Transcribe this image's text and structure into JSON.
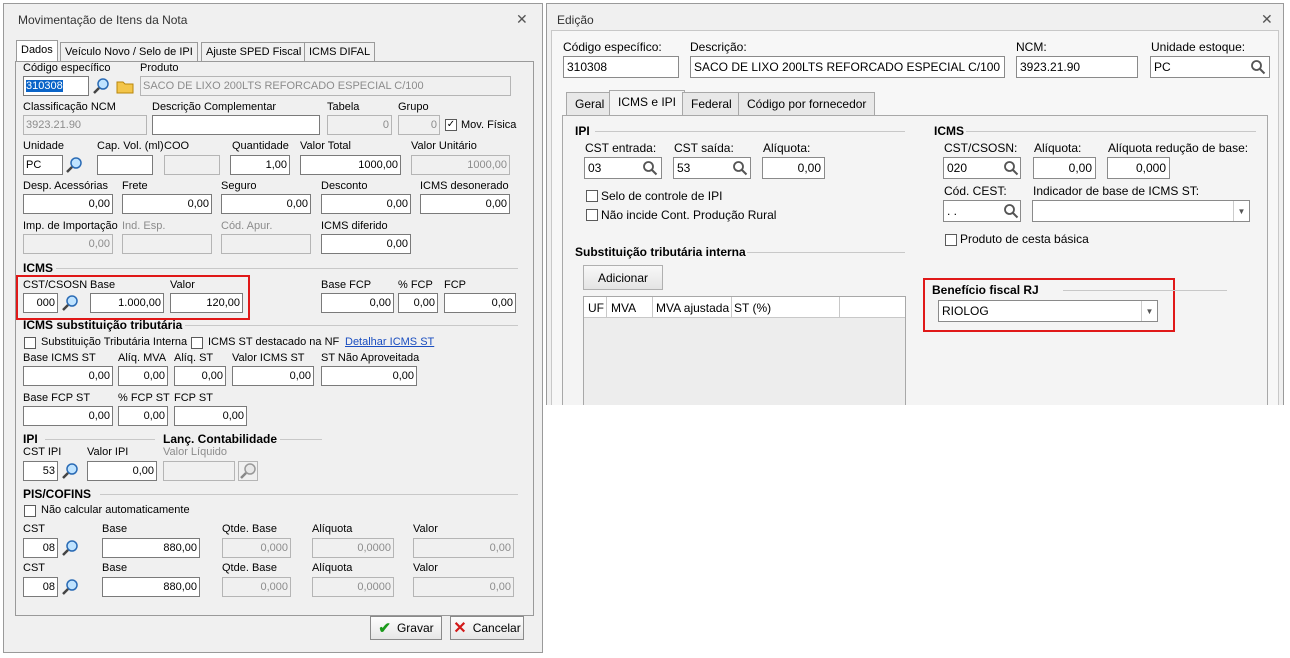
{
  "left": {
    "title": "Movimentação de Itens da Nota",
    "tabs": [
      "Dados",
      "Veículo Novo / Selo de IPI",
      "Ajuste SPED Fiscal",
      "ICMS DIFAL"
    ],
    "codigo_especifico_label": "Código específico",
    "codigo_especifico": "310308",
    "produto_label": "Produto",
    "produto": "SACO DE LIXO 200LTS REFORCADO ESPECIAL C/100",
    "classificacao_ncm_label": "Classificação NCM",
    "classificacao_ncm": "3923.21.90",
    "descricao_complementar_label": "Descrição Complementar",
    "descricao_complementar": "",
    "tabela_label": "Tabela",
    "tabela": "0",
    "grupo_label": "Grupo",
    "grupo": "0",
    "mov_fisica_label": "Mov. Física",
    "mov_fisica_check": "✓",
    "unidade_label": "Unidade",
    "unidade": "PC",
    "cap_vol_label": "Cap. Vol. (ml)",
    "coo_label": "COO",
    "quantidade_label": "Quantidade",
    "quantidade": "1,00",
    "valor_total_label": "Valor Total",
    "valor_total": "1000,00",
    "valor_unitario_label": "Valor Unitário",
    "valor_unitario": "1000,00",
    "desp_acessorias_label": "Desp. Acessórias",
    "desp_acessorias": "0,00",
    "frete_label": "Frete",
    "frete": "0,00",
    "seguro_label": "Seguro",
    "seguro": "0,00",
    "desconto_label": "Desconto",
    "desconto": "0,00",
    "icms_desonerado_label": "ICMS desonerado",
    "icms_desonerado": "0,00",
    "imp_importacao_label": "Imp. de Importação",
    "imp_importacao": "0,00",
    "ind_esp_label": "Ind. Esp.",
    "cod_apur_label": "Cód. Apur.",
    "icms_diferido_label": "ICMS diferido",
    "icms_diferido": "0,00",
    "icms_section": "ICMS",
    "cst_csosn_label": "CST/CSOSN",
    "cst_csosn": "000",
    "base_label": "Base",
    "base": "1.000,00",
    "valor_label": "Valor",
    "valor": "120,00",
    "base_fcp_label": "Base FCP",
    "base_fcp": "0,00",
    "pct_fcp_label": "% FCP",
    "pct_fcp": "0,00",
    "fcp_label": "FCP",
    "fcp": "0,00",
    "icms_st_section": "ICMS substituição tributária",
    "subst_trib_interna_label": "Substituição Tributária Interna",
    "icms_st_destacado_label": "ICMS ST destacado na NF",
    "detalhar_icms_st": "Detalhar ICMS ST",
    "base_icms_st_label": "Base ICMS ST",
    "base_icms_st": "0,00",
    "aliq_mva_label": "Alíq. MVA",
    "aliq_mva": "0,00",
    "aliq_st_label": "Alíq. ST",
    "aliq_st": "0,00",
    "valor_icms_st_label": "Valor ICMS ST",
    "valor_icms_st": "0,00",
    "st_nao_aproveitada_label": "ST Não Aproveitada",
    "st_nao_aproveitada": "0,00",
    "base_fcp_st_label": "Base FCP ST",
    "base_fcp_st": "0,00",
    "pct_fcp_st_label": "% FCP ST",
    "pct_fcp_st": "0,00",
    "fcp_st_label": "FCP ST",
    "fcp_st": "0,00",
    "ipi_section": "IPI",
    "lanc_contabilidade_section": "Lanç. Contabilidade",
    "cst_ipi_label": "CST IPI",
    "cst_ipi": "53",
    "valor_ipi_label": "Valor IPI",
    "valor_ipi": "0,00",
    "valor_liquido_label": "Valor Líquido",
    "pis_cofins_section": "PIS/COFINS",
    "nao_calcular_label": "Não calcular automaticamente",
    "cst_label": "CST",
    "base2_label": "Base",
    "qtde_base_label": "Qtde. Base",
    "aliquota_label": "Alíquota",
    "valor2_label": "Valor",
    "pis": {
      "cst": "08",
      "base": "880,00",
      "qtde_base": "0,000",
      "aliquota": "0,0000",
      "valor": "0,00"
    },
    "cofins": {
      "cst": "08",
      "base": "880,00",
      "qtde_base": "0,000",
      "aliquota": "0,0000",
      "valor": "0,00"
    },
    "gravar": "Gravar",
    "cancelar": "Cancelar"
  },
  "right": {
    "title": "Edição",
    "codigo_especifico_label": "Código específico:",
    "codigo_especifico": "310308",
    "descricao_label": "Descrição:",
    "descricao": "SACO DE LIXO 200LTS REFORCADO ESPECIAL C/100",
    "ncm_label": "NCM:",
    "ncm": "3923.21.90",
    "unidade_estoque_label": "Unidade estoque:",
    "unidade_estoque": "PC",
    "tabs": [
      "Geral",
      "ICMS e IPI",
      "Federal",
      "Código por fornecedor"
    ],
    "ipi_section": "IPI",
    "cst_entrada_label": "CST entrada:",
    "cst_entrada": "03",
    "cst_saida_label": "CST saída:",
    "cst_saida": "53",
    "aliquota_label": "Alíquota:",
    "aliquota": "0,00",
    "selo_controle_label": "Selo de controle de IPI",
    "nao_incide_label": "Não incide Cont. Produção Rural",
    "subst_section": "Substituição tributária interna",
    "adicionar": "Adicionar",
    "grid_cols": [
      "UF",
      "MVA",
      "MVA ajustada",
      "ST (%)"
    ],
    "icms_section": "ICMS",
    "cst_csosn_label": "CST/CSOSN:",
    "cst_csosn": "020",
    "icms_aliquota_label": "Alíquota:",
    "icms_aliquota": "0,00",
    "aliq_reducao_label": "Alíquota redução de base:",
    "aliq_reducao": "0,000",
    "cod_cest_label": "Cód. CEST:",
    "cod_cest": " .  .",
    "indicador_base_label": "Indicador de base de ICMS ST:",
    "indicador_base": "",
    "cesta_basica_label": "Produto de cesta básica",
    "beneficio_section": "Benefício fiscal RJ",
    "beneficio": "RIOLOG"
  }
}
